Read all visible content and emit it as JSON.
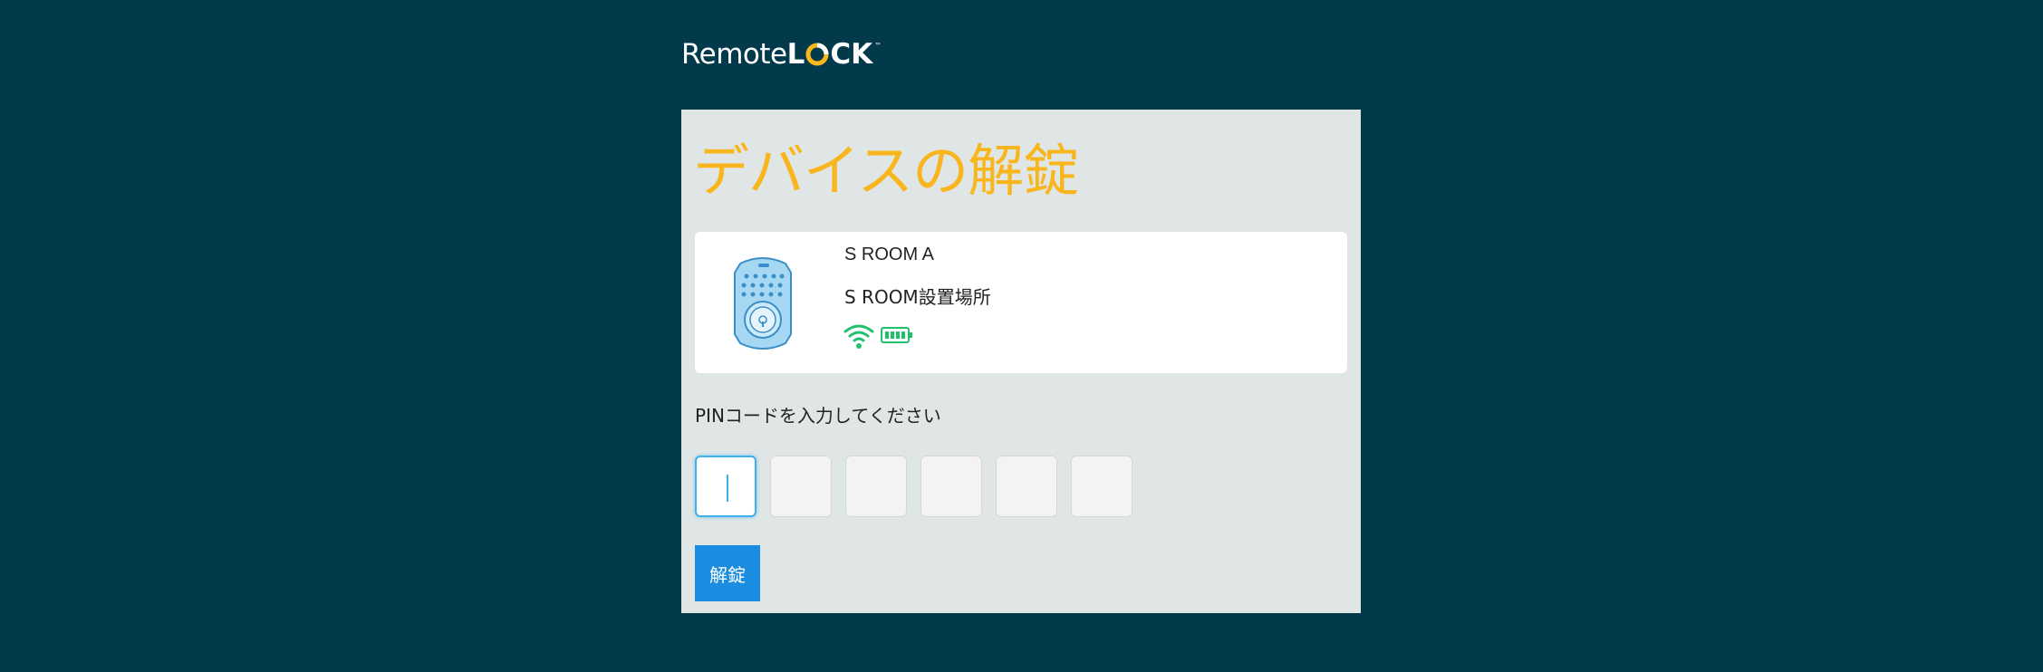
{
  "logo": {
    "remote": "Remote",
    "lock_l": "L",
    "lock_ck": "CK",
    "tm": "™"
  },
  "page": {
    "title": "デバイスの解錠"
  },
  "device": {
    "name": "S ROOM A",
    "location": "S ROOM設置場所",
    "image_icon": "deadbolt-lock-icon",
    "wifi_icon": "wifi-icon",
    "battery_icon": "battery-full-icon",
    "status_color": "#1fc16b"
  },
  "pin": {
    "prompt": "PINコードを入力してください",
    "digits": [
      "",
      "",
      "",
      "",
      "",
      ""
    ]
  },
  "unlock_button": {
    "label": "解錠",
    "color": "#1a8de0"
  },
  "colors": {
    "background": "#023a4c",
    "panel": "#e0e6e6",
    "title": "#f8b51c"
  }
}
